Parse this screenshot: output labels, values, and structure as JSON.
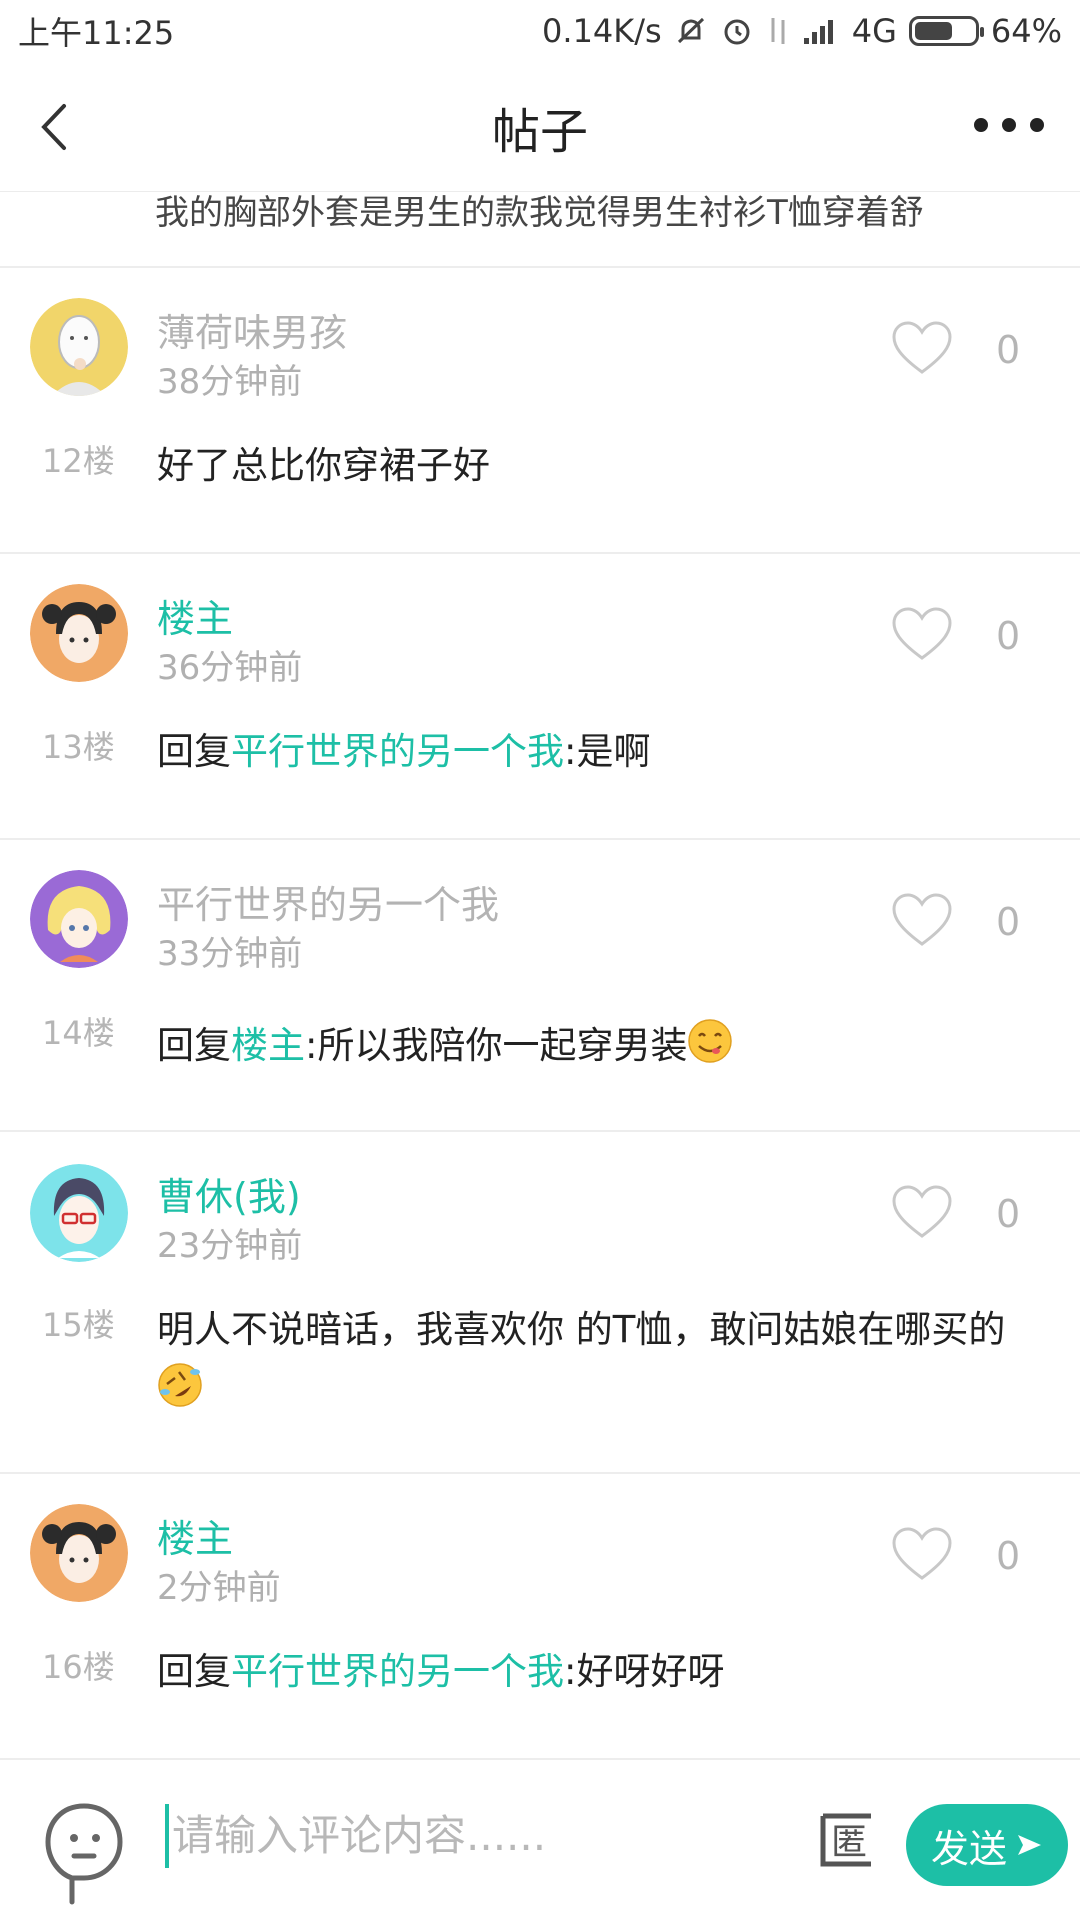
{
  "status_bar": {
    "time": "上午11:25",
    "speed": "0.14K/s",
    "network": "4G",
    "battery": "64%",
    "battery_level": 0.64
  },
  "header": {
    "title": "帖子"
  },
  "clipped_text": "我的胸部外套是男生的款我觉得男生衬衫T恤穿着舒",
  "posts": [
    {
      "name": "薄荷味男孩",
      "name_color": "gray",
      "time": "38分钟前",
      "likes": "0",
      "floor": "12楼",
      "content": "好了总比你穿裙子好"
    },
    {
      "name": "楼主",
      "name_color": "teal",
      "time": "36分钟前",
      "likes": "0",
      "floor": "13楼",
      "reply_prefix": "回复",
      "reply_to": "平行世界的另一个我",
      "reply_text": ":是啊"
    },
    {
      "name": "平行世界的另一个我",
      "name_color": "gray",
      "time": "33分钟前",
      "likes": "0",
      "floor": "14楼",
      "reply_prefix": "回复",
      "reply_to": "楼主",
      "reply_text": ":所以我陪你一起穿男装"
    },
    {
      "name": "曹休(我)",
      "name_color": "teal",
      "time": "23分钟前",
      "likes": "0",
      "floor": "15楼",
      "content": "明人不说暗话，我喜欢你  的T恤，敢问姑娘在哪买的"
    },
    {
      "name": "楼主",
      "name_color": "teal",
      "time": "2分钟前",
      "likes": "0",
      "floor": "16楼",
      "reply_prefix": "回复",
      "reply_to": "平行世界的另一个我",
      "reply_text": ":好呀好呀"
    }
  ],
  "input": {
    "placeholder": "请输入评论内容......"
  },
  "send_label": "发送",
  "anon_label": "匿",
  "colors": {
    "accent": "#1dbfa6",
    "muted": "#b3b3b3"
  }
}
